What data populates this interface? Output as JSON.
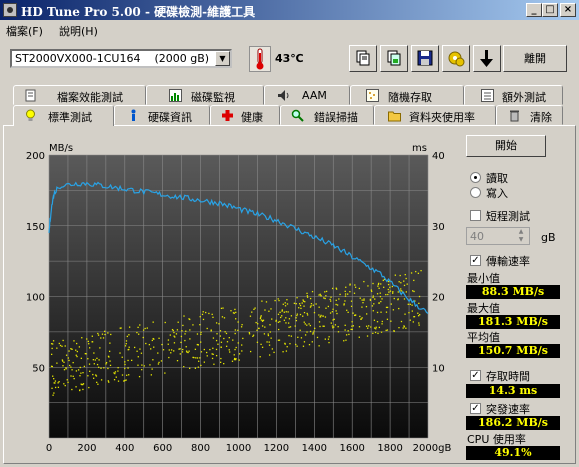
{
  "window": {
    "title": "HD Tune Pro  5.00 - 硬碟檢測-維護工具"
  },
  "menu": [
    {
      "label": "檔案(F)"
    },
    {
      "label": "說明(H)"
    }
  ],
  "toolbar": {
    "drive": "ST2000VX000-1CU164",
    "drive_capacity": "(2000 gB)",
    "temperature": "43℃",
    "exit_label": "離開"
  },
  "tabs_top": [
    {
      "label": "檔案效能測試"
    },
    {
      "label": "磁碟監視"
    },
    {
      "label": "AAM"
    },
    {
      "label": "隨機存取"
    },
    {
      "label": "額外測試"
    }
  ],
  "tabs_bottom": [
    {
      "label": "標準測試"
    },
    {
      "label": "硬碟資訊"
    },
    {
      "label": "健康"
    },
    {
      "label": "錯誤掃描"
    },
    {
      "label": "資料夾使用率"
    },
    {
      "label": "清除"
    }
  ],
  "side": {
    "start_label": "開始",
    "read_label": "讀取",
    "write_label": "寫入",
    "short_test_label": "短程測試",
    "block_value": "40",
    "block_unit": "gB",
    "transfer_rate_label": "傳輸速率",
    "min_label": "最小值",
    "min_value": "88.3 MB/s",
    "max_label": "最大值",
    "max_value": "181.3 MB/s",
    "avg_label": "平均值",
    "avg_value": "150.7 MB/s",
    "access_time_label": "存取時間",
    "access_time_value": "14.3 ms",
    "burst_rate_label": "突發速率",
    "burst_rate_value": "186.2 MB/s",
    "cpu_label": "CPU 使用率",
    "cpu_value": "49.1%"
  },
  "chart_data": {
    "type": "line",
    "left_axis_unit": "MB/s",
    "right_axis_unit": "ms",
    "x_unit_label": "2000gB",
    "x_ticks": [
      0,
      200,
      400,
      600,
      800,
      1000,
      1200,
      1400,
      1600,
      1800
    ],
    "y_ticks_left": [
      50,
      100,
      150,
      200
    ],
    "y_ticks_right": [
      10,
      20,
      30,
      40
    ],
    "xlim": [
      0,
      2000
    ],
    "ylim_left": [
      0,
      200
    ],
    "ylim_right": [
      0,
      40
    ],
    "series": [
      {
        "color": "#29a3e6",
        "x": [
          0,
          10,
          25,
          50,
          100,
          150,
          200,
          250,
          300,
          350,
          400,
          450,
          500,
          550,
          600,
          650,
          700,
          750,
          800,
          850,
          900,
          950,
          1000,
          1050,
          1100,
          1150,
          1200,
          1250,
          1300,
          1350,
          1400,
          1450,
          1500,
          1550,
          1600,
          1650,
          1700,
          1750,
          1800,
          1850,
          1900,
          1950,
          2000
        ],
        "y": [
          145,
          160,
          172,
          178,
          179,
          180,
          180,
          179,
          178,
          177,
          176,
          175,
          174,
          173,
          172,
          171,
          170,
          169,
          168,
          167,
          166,
          164,
          162,
          160,
          158,
          156,
          154,
          151,
          148,
          145,
          142,
          139,
          136,
          132,
          128,
          124,
          120,
          116,
          110,
          104,
          98,
          93,
          88
        ]
      }
    ],
    "access_time_scatter": {
      "color": "#e8e800",
      "description_range_ms": [
        8,
        22
      ]
    }
  }
}
